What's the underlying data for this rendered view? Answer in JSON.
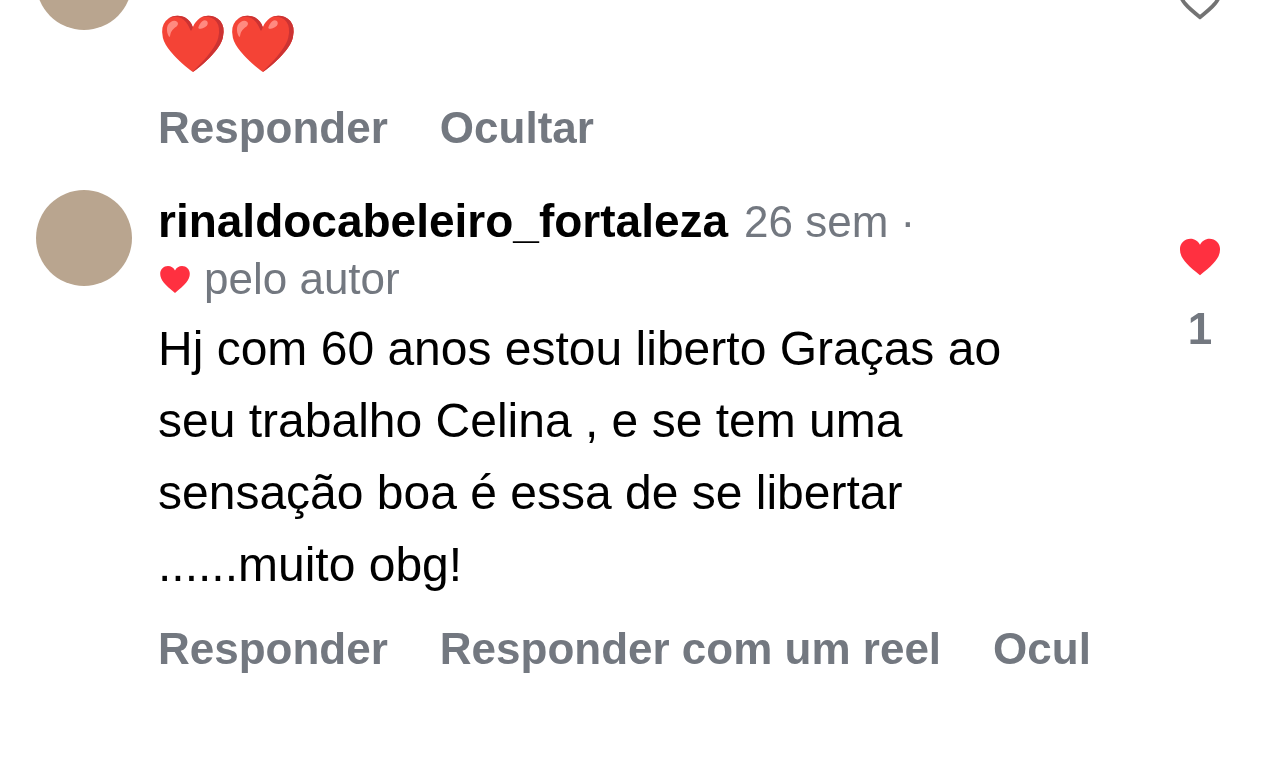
{
  "comments": [
    {
      "body": "❤️❤️",
      "liked": false,
      "actions": [
        "Responder",
        "Ocultar"
      ]
    },
    {
      "username": "rinaldocabeleiro_fortaleza",
      "time": "26 sem ·",
      "author_liked": true,
      "author_label": "pelo autor",
      "body": "Hj com 60 anos estou liberto Graças ao seu trabalho Celina , e se tem uma sensação boa é essa de se libertar ......muito obg!",
      "liked": true,
      "like_count": "1",
      "actions": [
        "Responder",
        "Responder com um reel",
        "Ocul"
      ]
    }
  ]
}
